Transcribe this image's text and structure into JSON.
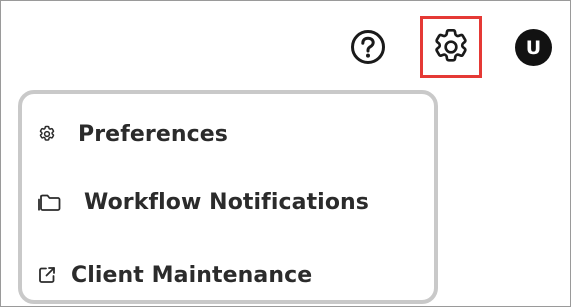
{
  "header": {
    "help_icon": "question-circle",
    "settings_icon": "gear",
    "avatar_initial": "U"
  },
  "colors": {
    "highlight_border": "#e53935",
    "avatar_bg": "#121212",
    "menu_border": "#c9c9c9",
    "text": "#2b2b2b"
  },
  "menu": {
    "items": [
      {
        "label": "Preferences",
        "icon": "gear"
      },
      {
        "label": "Workflow Notifications",
        "icon": "folder"
      },
      {
        "label": "Client Maintenance",
        "icon": "external-link"
      }
    ]
  }
}
